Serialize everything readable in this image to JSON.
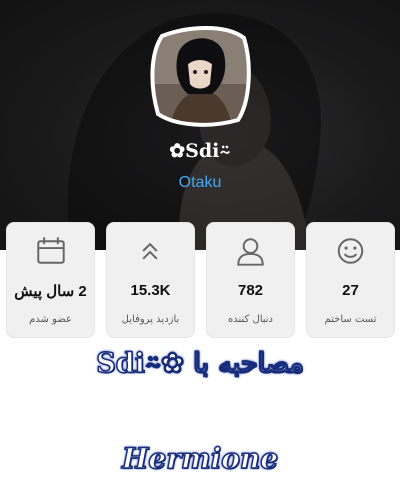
{
  "profile": {
    "username": "✿Sdi⍨",
    "tagline": "Otaku"
  },
  "stats": [
    {
      "icon": "calendar-icon",
      "value": "2 سال پیش",
      "label": "عضو شدم"
    },
    {
      "icon": "double-chevron-up-icon",
      "value": "15.3K",
      "label": "بازدید پروفایل"
    },
    {
      "icon": "user-icon",
      "value": "782",
      "label": "دنبال کننده"
    },
    {
      "icon": "smiley-icon",
      "value": "27",
      "label": "تست ساختم"
    }
  ],
  "post": {
    "title": "مصاحبه با ✿Sdi⍨",
    "subtitle": "Hermione"
  },
  "colors": {
    "accent": "#46a6f2",
    "header_bg": "#1c1c1d",
    "card_bg": "#f0f0f0",
    "title_outline": "#162b7a"
  }
}
